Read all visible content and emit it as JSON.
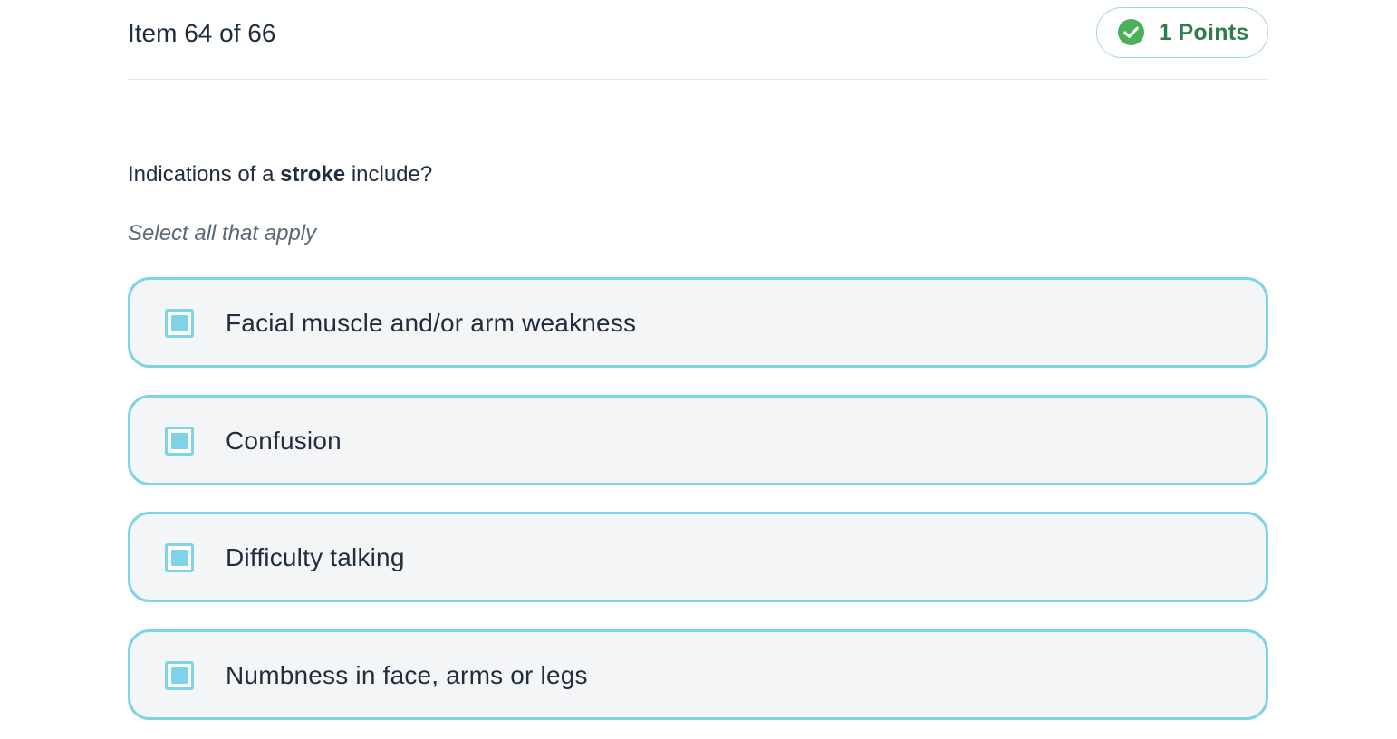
{
  "header": {
    "item_counter": "Item 64 of 66",
    "points_label": "1 Points",
    "points_icon": "check-circle-icon",
    "points_color": "#4cb05a"
  },
  "question": {
    "prefix": "Indications of a ",
    "emphasis": "stroke",
    "suffix": " include?",
    "instruction": "Select all that apply"
  },
  "options": [
    {
      "label": "Facial muscle and/or arm weakness",
      "selected": true
    },
    {
      "label": "Confusion",
      "selected": true
    },
    {
      "label": "Difficulty talking",
      "selected": true
    },
    {
      "label": "Numbness in face, arms or legs",
      "selected": true
    }
  ],
  "colors": {
    "accent": "#7fd3e6",
    "option_bg": "#f3f5f7",
    "text": "#1f2d3d",
    "success": "#4cb05a"
  }
}
